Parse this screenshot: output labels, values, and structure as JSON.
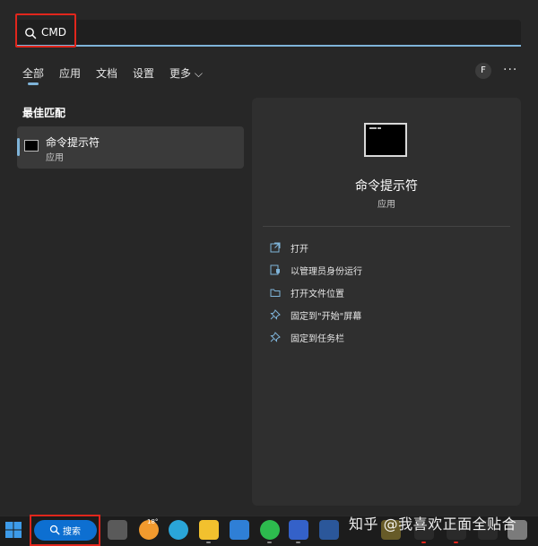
{
  "search": {
    "query": "CMD"
  },
  "tabs": [
    {
      "label": "全部"
    },
    {
      "label": "应用"
    },
    {
      "label": "文档"
    },
    {
      "label": "设置"
    },
    {
      "label": "更多 ⌵"
    }
  ],
  "account": {
    "initial": "F"
  },
  "more_menu": "···",
  "best_match": {
    "heading": "最佳匹配",
    "title": "命令提示符",
    "type": "应用"
  },
  "detail": {
    "title": "命令提示符",
    "type": "应用",
    "actions": [
      {
        "label": "打开",
        "icon": "open-icon"
      },
      {
        "label": "以管理员身份运行",
        "icon": "shield-icon"
      },
      {
        "label": "打开文件位置",
        "icon": "folder-icon"
      },
      {
        "label": "固定到\"开始\"屏幕",
        "icon": "pin-icon"
      },
      {
        "label": "固定到任务栏",
        "icon": "pin-icon"
      }
    ]
  },
  "taskbar": {
    "search_label": "搜索",
    "weather_temp": "18°",
    "apps": [
      "task-view-icon",
      "weather-icon",
      "edge-icon",
      "file-explorer-icon",
      "mail-icon",
      "wechat-icon",
      "app-icon",
      "word-icon",
      "app-icon",
      "app-icon",
      "app-icon",
      "app-icon",
      "app-icon"
    ]
  },
  "watermark": "知乎 @我喜欢正面全贴合",
  "colors": {
    "accent": "#7fb4d9",
    "highlight_box": "#e0261c",
    "search_button": "#0d6fd1"
  }
}
